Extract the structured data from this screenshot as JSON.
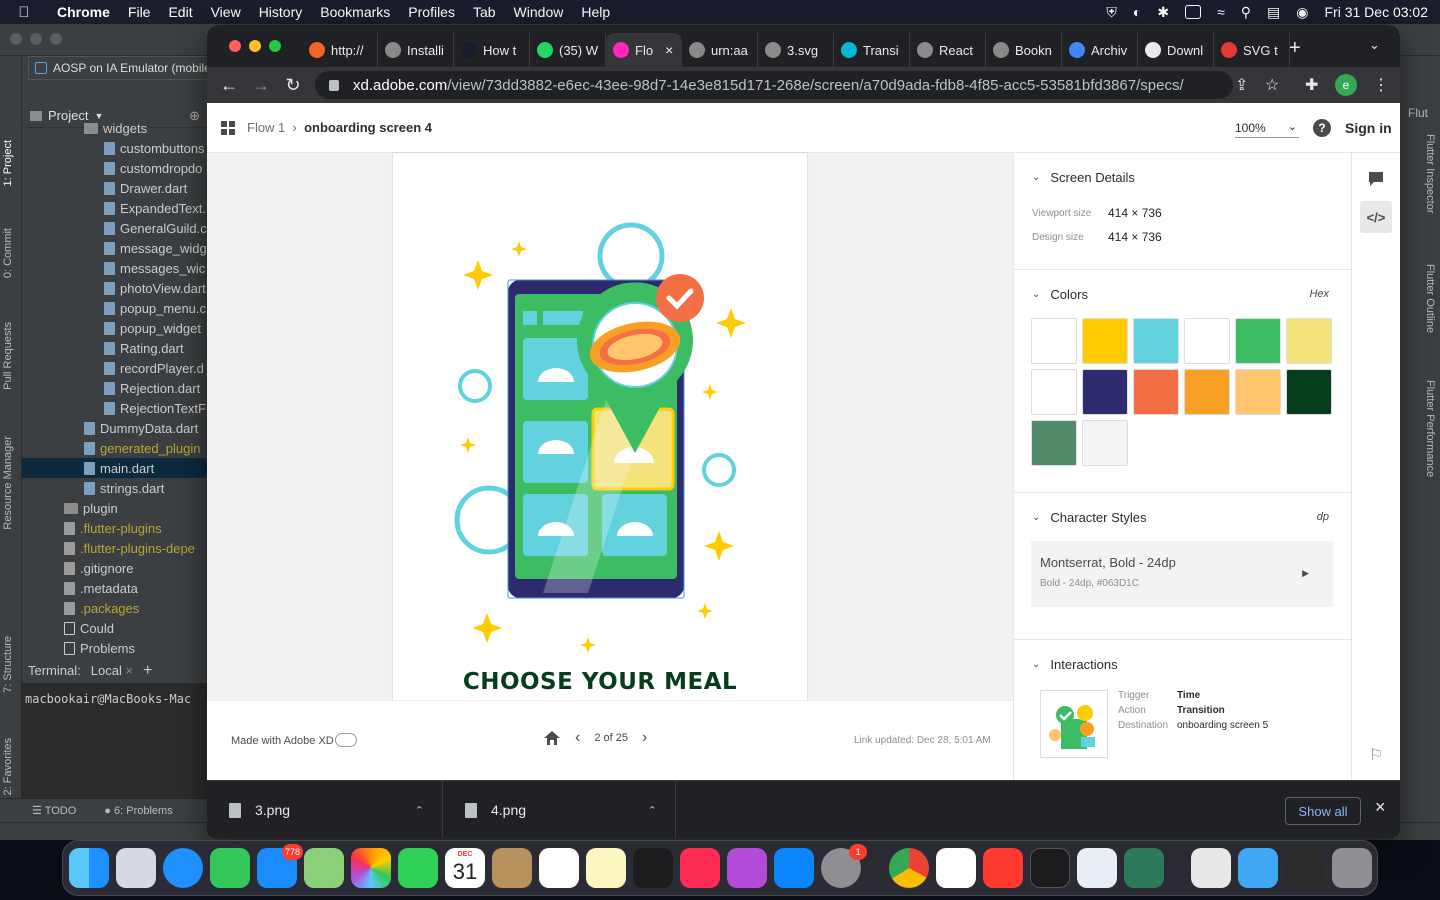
{
  "menubar": {
    "app": "Chrome",
    "items": [
      "File",
      "Edit",
      "View",
      "History",
      "Bookmarks",
      "Profiles",
      "Tab",
      "Window",
      "Help"
    ],
    "clock": "Fri 31 Dec  03:02"
  },
  "ide": {
    "run_config": "AOSP on IA Emulator (mobile",
    "project_label": "Project",
    "tree": [
      {
        "label": "widgets",
        "type": "dir",
        "depth": 3
      },
      {
        "label": "custombuttons",
        "type": "file",
        "depth": 4
      },
      {
        "label": "customdropdo",
        "type": "file",
        "depth": 4
      },
      {
        "label": "Drawer.dart",
        "type": "file",
        "depth": 4
      },
      {
        "label": "ExpandedText.",
        "type": "file",
        "depth": 4
      },
      {
        "label": "GeneralGuild.c",
        "type": "file",
        "depth": 4
      },
      {
        "label": "message_widg",
        "type": "file",
        "depth": 4
      },
      {
        "label": "messages_wic",
        "type": "file",
        "depth": 4
      },
      {
        "label": "photoView.dart",
        "type": "file",
        "depth": 4
      },
      {
        "label": "popup_menu.c",
        "type": "file",
        "depth": 4
      },
      {
        "label": "popup_widget",
        "type": "file",
        "depth": 4
      },
      {
        "label": "Rating.dart",
        "type": "file",
        "depth": 4
      },
      {
        "label": "recordPlayer.d",
        "type": "file",
        "depth": 4
      },
      {
        "label": "Rejection.dart",
        "type": "file",
        "depth": 4
      },
      {
        "label": "RejectionTextF",
        "type": "file",
        "depth": 4
      },
      {
        "label": "DummyData.dart",
        "type": "file",
        "depth": 3
      },
      {
        "label": "generated_plugin",
        "type": "file",
        "depth": 3,
        "gold": true
      },
      {
        "label": "main.dart",
        "type": "file",
        "depth": 3,
        "selected": true
      },
      {
        "label": "strings.dart",
        "type": "file",
        "depth": 3
      },
      {
        "label": "plugin",
        "type": "dir",
        "depth": 2
      },
      {
        "label": ".flutter-plugins",
        "type": "gen",
        "depth": 2,
        "gold": true
      },
      {
        "label": ".flutter-plugins-depe",
        "type": "gen",
        "depth": 2,
        "gold": true
      },
      {
        "label": ".gitignore",
        "type": "gen",
        "depth": 2
      },
      {
        "label": ".metadata",
        "type": "gen",
        "depth": 2
      },
      {
        "label": ".packages",
        "type": "gen",
        "depth": 2,
        "gold": true
      },
      {
        "label": "Could",
        "type": "box",
        "depth": 2
      },
      {
        "label": "Problems",
        "type": "box",
        "depth": 2
      }
    ],
    "left_tabs": [
      "1: Project",
      "0: Commit",
      "Pull Requests",
      "Resource Manager",
      "7: Structure",
      "2: Favorites"
    ],
    "right_tabs": [
      "Flutter Inspector",
      "Flutter Outline",
      "Flutter Performance"
    ],
    "right_label": "Flut",
    "terminal_label": "Terminal:",
    "terminal_tab": "Local",
    "terminal_line": "macbookair@MacBooks-Mac",
    "bottom_tabs": [
      "TODO",
      "6: Problems"
    ]
  },
  "browser": {
    "tabs": [
      {
        "label": "http://",
        "favicon_color": "#f26522"
      },
      {
        "label": "Installi",
        "favicon_color": "#8a8a8a"
      },
      {
        "label": "How t",
        "favicon_color": "#1a1a2e"
      },
      {
        "label": "(35) W",
        "favicon_color": "#25d366"
      },
      {
        "label": "Flo",
        "favicon_color": "#ff26be",
        "active": true
      },
      {
        "label": "urn:aa",
        "favicon_color": "#8a8a8a"
      },
      {
        "label": "3.svg",
        "favicon_color": "#8a8a8a"
      },
      {
        "label": "Transi",
        "favicon_color": "#06b6d4"
      },
      {
        "label": "React",
        "favicon_color": "#8a8a8a"
      },
      {
        "label": "Bookn",
        "favicon_color": "#8a8a8a"
      },
      {
        "label": "Archiv",
        "favicon_color": "#4285f4"
      },
      {
        "label": "Downl",
        "favicon_color": "#e8eaed"
      },
      {
        "label": "SVG t",
        "favicon_color": "#e53935"
      }
    ],
    "url_host": "xd.adobe.com",
    "url_path": "/view/73dd3882-e6ec-43ee-98d7-14e3e815d171-268e/screen/a70d9ada-fdb8-4f85-acc5-53581bfd3867/specs/",
    "profile_initial": "e"
  },
  "xd": {
    "breadcrumb_parent": "Flow 1",
    "breadcrumb_current": "onboarding screen 4",
    "zoom": "100%",
    "signin": "Sign in",
    "headline": "CHOOSE YOUR MEAL",
    "made_with": "Made with Adobe XD",
    "pager": "2 of 25",
    "link_updated": "Link updated: Dec 28, 5:01 AM",
    "screen_details": {
      "title": "Screen Details",
      "viewport_label": "Viewport size",
      "viewport_value": "414 × 736",
      "design_label": "Design size",
      "design_value": "414 × 736"
    },
    "colors": {
      "title": "Colors",
      "unit": "Hex",
      "swatches": [
        "#ffffff",
        "#ffcc00",
        "#62d2de",
        "#ffffff",
        "#3cbd64",
        "#f4e27a",
        "#ffffff",
        "#2d2b6e",
        "#f56f44",
        "#f8a024",
        "#ffc46e",
        "#063d1c",
        "#548a6c",
        "#f5f4f4"
      ]
    },
    "character_styles": {
      "title": "Character Styles",
      "unit": "dp",
      "style_name": "Montserrat, Bold - 24dp",
      "style_detail": "Bold - 24dp, #063D1C"
    },
    "interactions": {
      "title": "Interactions",
      "trigger_label": "Trigger",
      "trigger_value": "Time",
      "action_label": "Action",
      "action_value": "Transition",
      "destination_label": "Destination",
      "destination_value": "onboarding screen 5"
    }
  },
  "downloads": {
    "items": [
      "3.png",
      "4.png"
    ],
    "show_all": "Show all"
  },
  "dock": {
    "mail_badge": "778",
    "settings_badge": "1",
    "calendar_month": "DEC",
    "calendar_day": "31"
  }
}
